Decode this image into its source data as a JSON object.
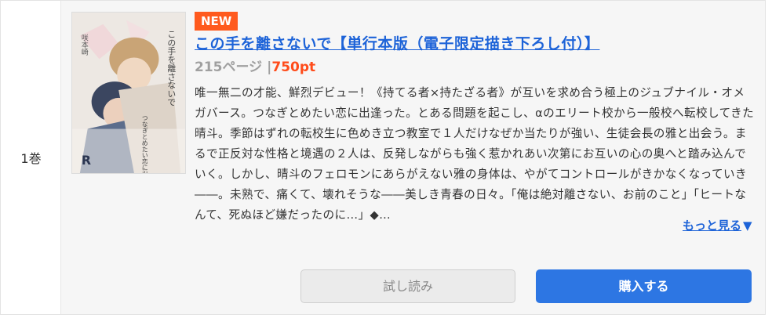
{
  "volume_label": "1巻",
  "badge": "NEW",
  "title": "この手を離さないで【単行本版（電子限定描き下ろし付）】",
  "meta": {
    "pages": "215ページ",
    "separator": "|",
    "price": "750pt"
  },
  "description": "唯一無二の才能、鮮烈デビュー！《持てる者×持たざる者》が互いを求め合う極上のジュブナイル・オメガバース。つなぎとめたい恋に出逢った。とある問題を起こし、αのエリート校から一般校へ転校してきた晴斗。季節はずれの転校生に色めき立つ教室で１人だけなぜか当たりが強い、生徒会長の雅と出会う。まるで正反対な性格と境遇の２人は、反発しながらも強く惹かれあい次第にお互いの心の奥へと踏み込んでいく。しかし、晴斗のフェロモンにあらがえない雅の身体は、やがてコントロールがきかなくなっていき――。未熟で、痛くて、壊れそうな――美しき青春の日々。「俺は絶対離さない、お前のこと」「ヒートなんて、死ぬほど嫌だったのに…」◆…",
  "more_link": {
    "label": "もっと見る",
    "arrow": "▼"
  },
  "buttons": {
    "sample": "試し読み",
    "buy": "購入する"
  },
  "cover": {
    "title_vertical": "この手を離さないで",
    "author_vertical": "咲本崎",
    "tagline_vertical": "つなぎとめたい恋に出逢った",
    "publisher_mark": "R"
  },
  "colors": {
    "badge": "#ff5a1e",
    "link": "#1d63d8",
    "price": "#ff4b1a",
    "buy_button": "#2d76e3",
    "sample_button": "#ebebeb"
  }
}
